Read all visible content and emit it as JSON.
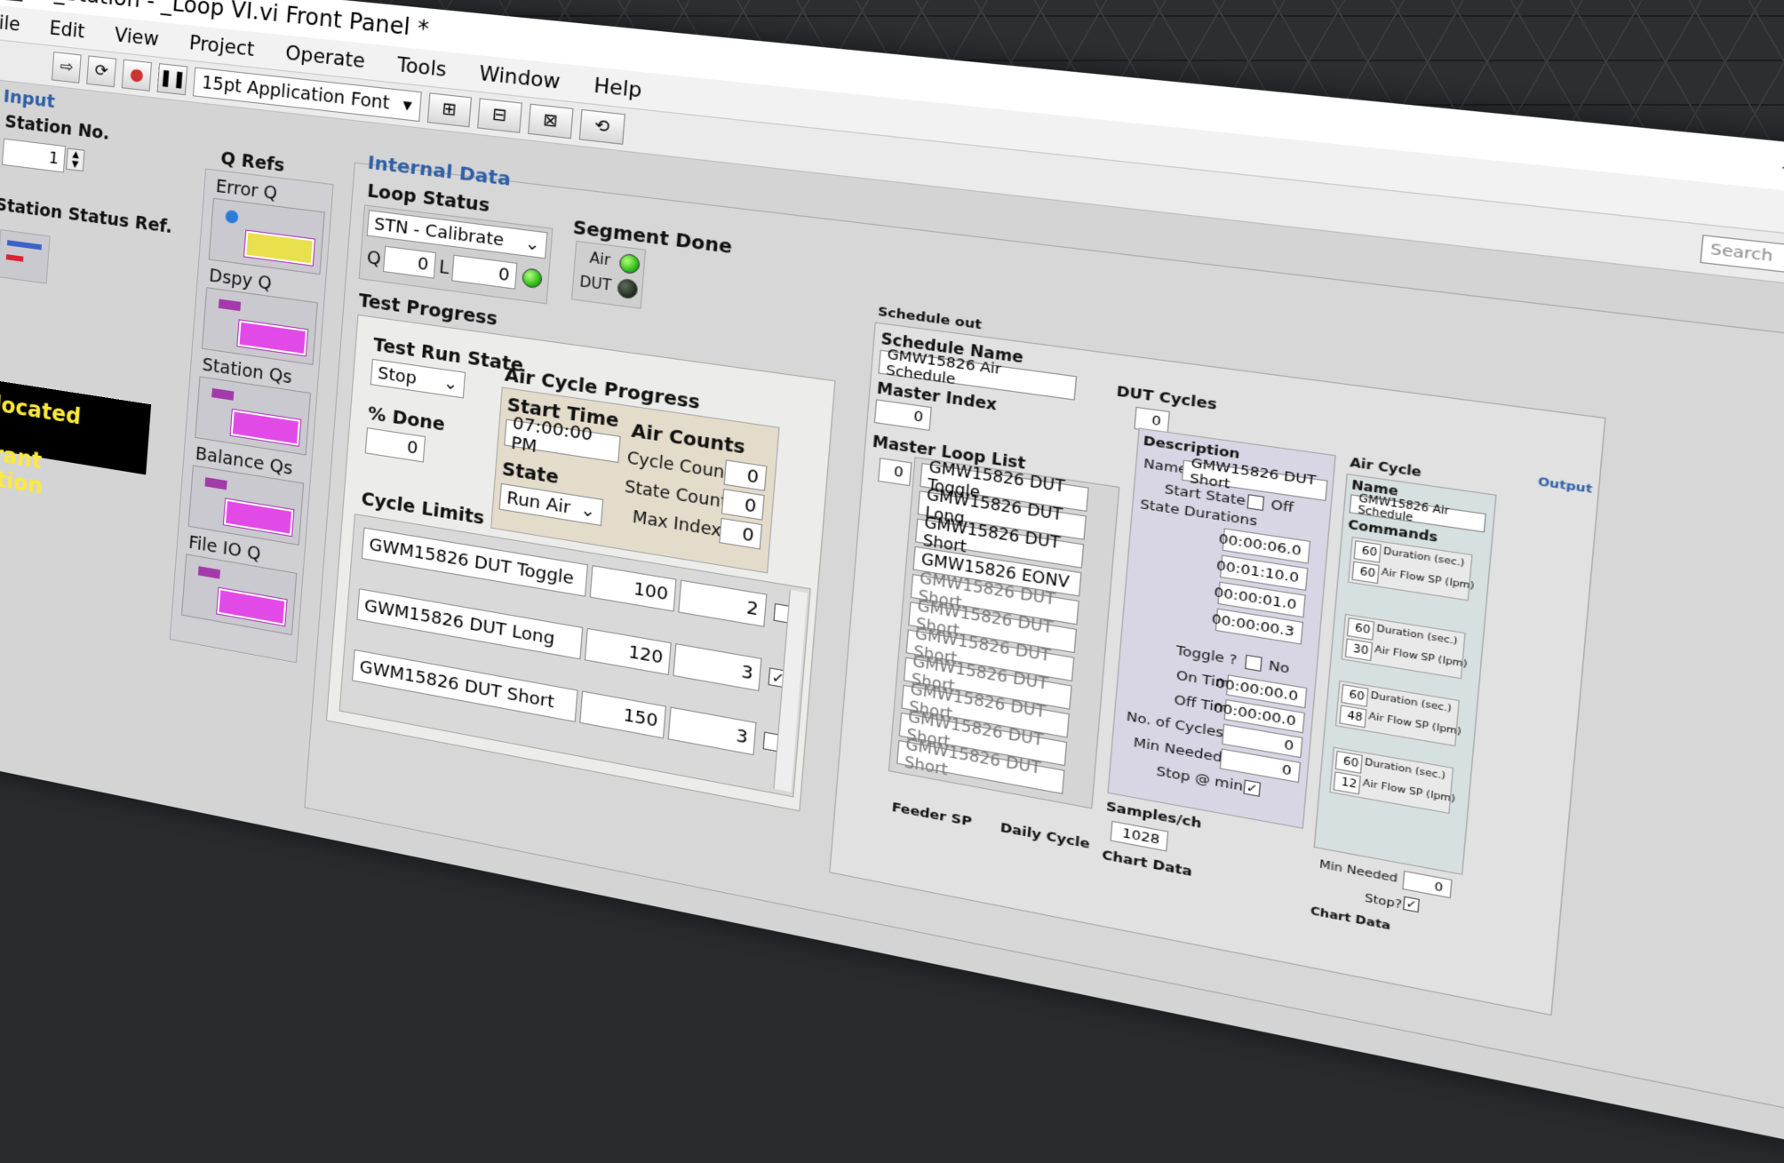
{
  "window": {
    "title": "sr_Station - _Loop VI.vi Front Panel *",
    "controls": [
      "–",
      "☐",
      "✕"
    ]
  },
  "menu": [
    "File",
    "Edit",
    "View",
    "Project",
    "Operate",
    "Tools",
    "Window",
    "Help"
  ],
  "toolbar": {
    "font": "15pt Application Font",
    "search_placeholder": "Search"
  },
  "input": {
    "title": "Input",
    "station_no_label": "Station No.",
    "station_no_value": "1",
    "status_ref_label": "Station Status Ref.",
    "note": "Preallocated clone\nreentrant execution"
  },
  "qrefs": {
    "title": "Q Refs",
    "items": [
      "Error Q",
      "Dspy Q",
      "Station Qs",
      "Balance Qs",
      "File IO Q"
    ]
  },
  "internal": {
    "title": "Internal Data",
    "loop_status_label": "Loop Status",
    "loop_status_value": "STN - Calibrate",
    "q_label": "Q",
    "q_value": "0",
    "l_label": "L",
    "l_value": "0",
    "segment_done_label": "Segment Done",
    "air_label": "Air",
    "dut_label": "DUT",
    "test_progress_label": "Test Progress",
    "test_run_state_label": "Test Run State",
    "test_run_state_value": "Stop",
    "pct_done_label": "% Done",
    "pct_done_value": "0",
    "air_cycle_progress_label": "Air Cycle Progress",
    "start_time_label": "Start Time",
    "start_time_value": "07:00:00 PM",
    "state_label": "State",
    "state_value": "Run Air",
    "air_counts_label": "Air Counts",
    "cycle_count_label": "Cycle Count",
    "cycle_count_value": "0",
    "state_count_label": "State Count",
    "state_count_value": "0",
    "max_index_label": "Max Index",
    "max_index_value": "0",
    "cycle_limits_label": "Cycle Limits",
    "cycle_limits": [
      {
        "name": "GWM15826 DUT Toggle",
        "value": "100",
        "count": "2",
        "checked": ""
      },
      {
        "name": "GWM15826 DUT Long",
        "value": "120",
        "count": "3",
        "checked": "✓"
      },
      {
        "name": "GWM15826 DUT Short",
        "value": "150",
        "count": "3",
        "checked": ""
      }
    ]
  },
  "schedule": {
    "title": "Schedule out",
    "name_label": "Schedule Name",
    "name_value": "GMW15826 Air Schedule",
    "master_index_label": "Master Index",
    "master_index_value": "0",
    "dut_cycles_label": "DUT Cycles",
    "dut_cycles_value": "0",
    "master_loop_label": "Master Loop List",
    "master_loop_index": "0",
    "master_loop": [
      "GMW15826 DUT Toggle",
      "GMW15826 DUT Long",
      "GMW15826 DUT Short",
      "GMW15826 EONV",
      "GMW15826 DUT Short",
      "GMW15826 DUT Short",
      "GMW15826 DUT Short",
      "GMW15826 DUT Short",
      "GMW15826 DUT Short",
      "GMW15826 DUT Short",
      "GMW15826 DUT Short"
    ],
    "description_label": "Description",
    "desc_name_label": "Name",
    "desc_name_value": "GMW15826 DUT Short",
    "start_state_label": "Start State",
    "start_state_value": "Off",
    "state_durations_label": "State Durations",
    "state_durations": [
      "00:00:06.0",
      "00:01:10.0",
      "00:00:01.0",
      "00:00:00.3"
    ],
    "toggle_label": "Toggle ?",
    "toggle_value": "No",
    "on_time_label": "On Time",
    "on_time_value": "00:00:00.0",
    "off_time_label": "Off Time",
    "off_time_value": "00:00:00.0",
    "num_cycles_label": "No. of Cycles",
    "num_cycles_value": "0",
    "min_needed_label": "Min Needed",
    "min_needed_value": "0",
    "stop_min_label": "Stop @ min?",
    "samples_label": "Samples/ch",
    "samples_value": "1028",
    "chart_data_label": "Chart Data",
    "feeder_label": "Feeder SP",
    "daily_cycle_label": "Daily Cycle",
    "air_cycle_label": "Air Cycle",
    "air_name_label": "Name",
    "air_name_value": "GMW15826 Air Schedule",
    "commands_label": "Commands",
    "commands": [
      {
        "duration": "60",
        "duration_label": "Duration (sec.)",
        "flow": "60",
        "flow_label": "Air Flow SP (lpm)"
      },
      {
        "duration": "60",
        "duration_label": "Duration (sec.)",
        "flow": "30",
        "flow_label": "Air Flow SP (lpm)"
      },
      {
        "duration": "60",
        "duration_label": "Duration (sec.)",
        "flow": "48",
        "flow_label": "Air Flow SP (lpm)"
      },
      {
        "duration": "60",
        "duration_label": "Duration (sec.)",
        "flow": "12",
        "flow_label": "Air Flow SP (lpm)"
      }
    ],
    "air_min_needed_label": "Min Needed",
    "air_min_needed_value": "0",
    "stop_label": "Stop?",
    "air_chart_label": "Chart Data",
    "output_label": "Output"
  }
}
